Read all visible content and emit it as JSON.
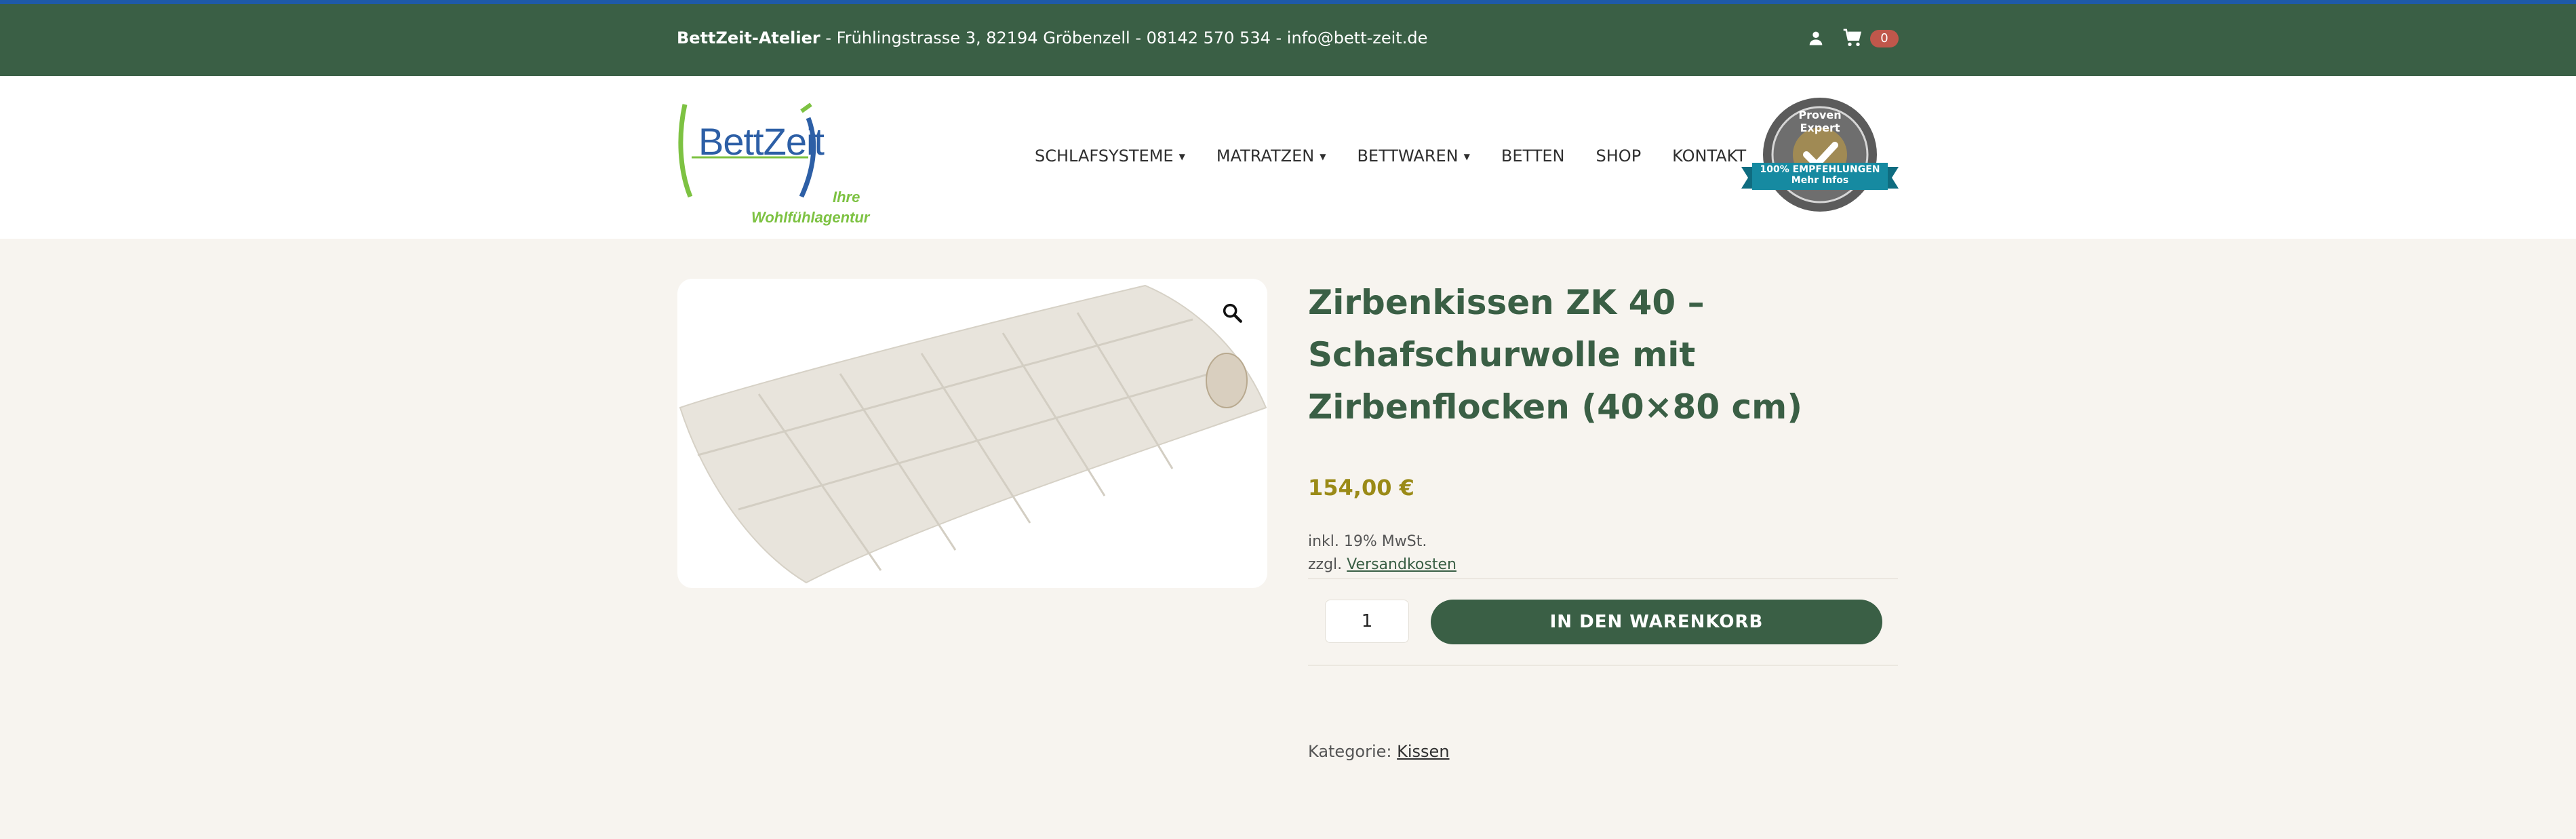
{
  "topbar": {
    "company": "BettZeit-Atelier",
    "address": " - Frühlingstrasse 3, 82194 Gröbenzell - 08142 570 534 - info@bett-zeit.de",
    "cart_count": "0"
  },
  "logo": {
    "word": "BettZeit",
    "tagline_1": "Ihre",
    "tagline_2": "Wohlfühlagentur"
  },
  "nav": {
    "items": [
      {
        "label": "SCHLAFSYSTEME",
        "has_dropdown": true
      },
      {
        "label": "MATRATZEN",
        "has_dropdown": true
      },
      {
        "label": "BETTWAREN",
        "has_dropdown": true
      },
      {
        "label": "BETTEN",
        "has_dropdown": false
      },
      {
        "label": "SHOP",
        "has_dropdown": false
      },
      {
        "label": "KONTAKT",
        "has_dropdown": false
      }
    ]
  },
  "badge": {
    "line_top": "Proven Expert",
    "ribbon_1": "100% EMPFEHLUNGEN",
    "ribbon_2": "Mehr Infos"
  },
  "product": {
    "title": "Zirbenkissen ZK 40 – Schafschurwolle mit Zirbenflocken (40×80 cm)",
    "price": "154,00 €",
    "tax_note": "inkl. 19% MwSt.",
    "shipping_prefix": "zzgl. ",
    "shipping_link": "Versandkosten",
    "quantity": "1",
    "add_to_cart": "IN DEN WARENKORB",
    "category_label": "Kategorie: ",
    "category_link": "Kissen"
  },
  "colors": {
    "brand_green": "#3a5f45",
    "price_olive": "#9a8a17",
    "cart_badge": "#c0574b",
    "accent_blue": "#1e5aa8",
    "background": "#f7f4ef"
  }
}
